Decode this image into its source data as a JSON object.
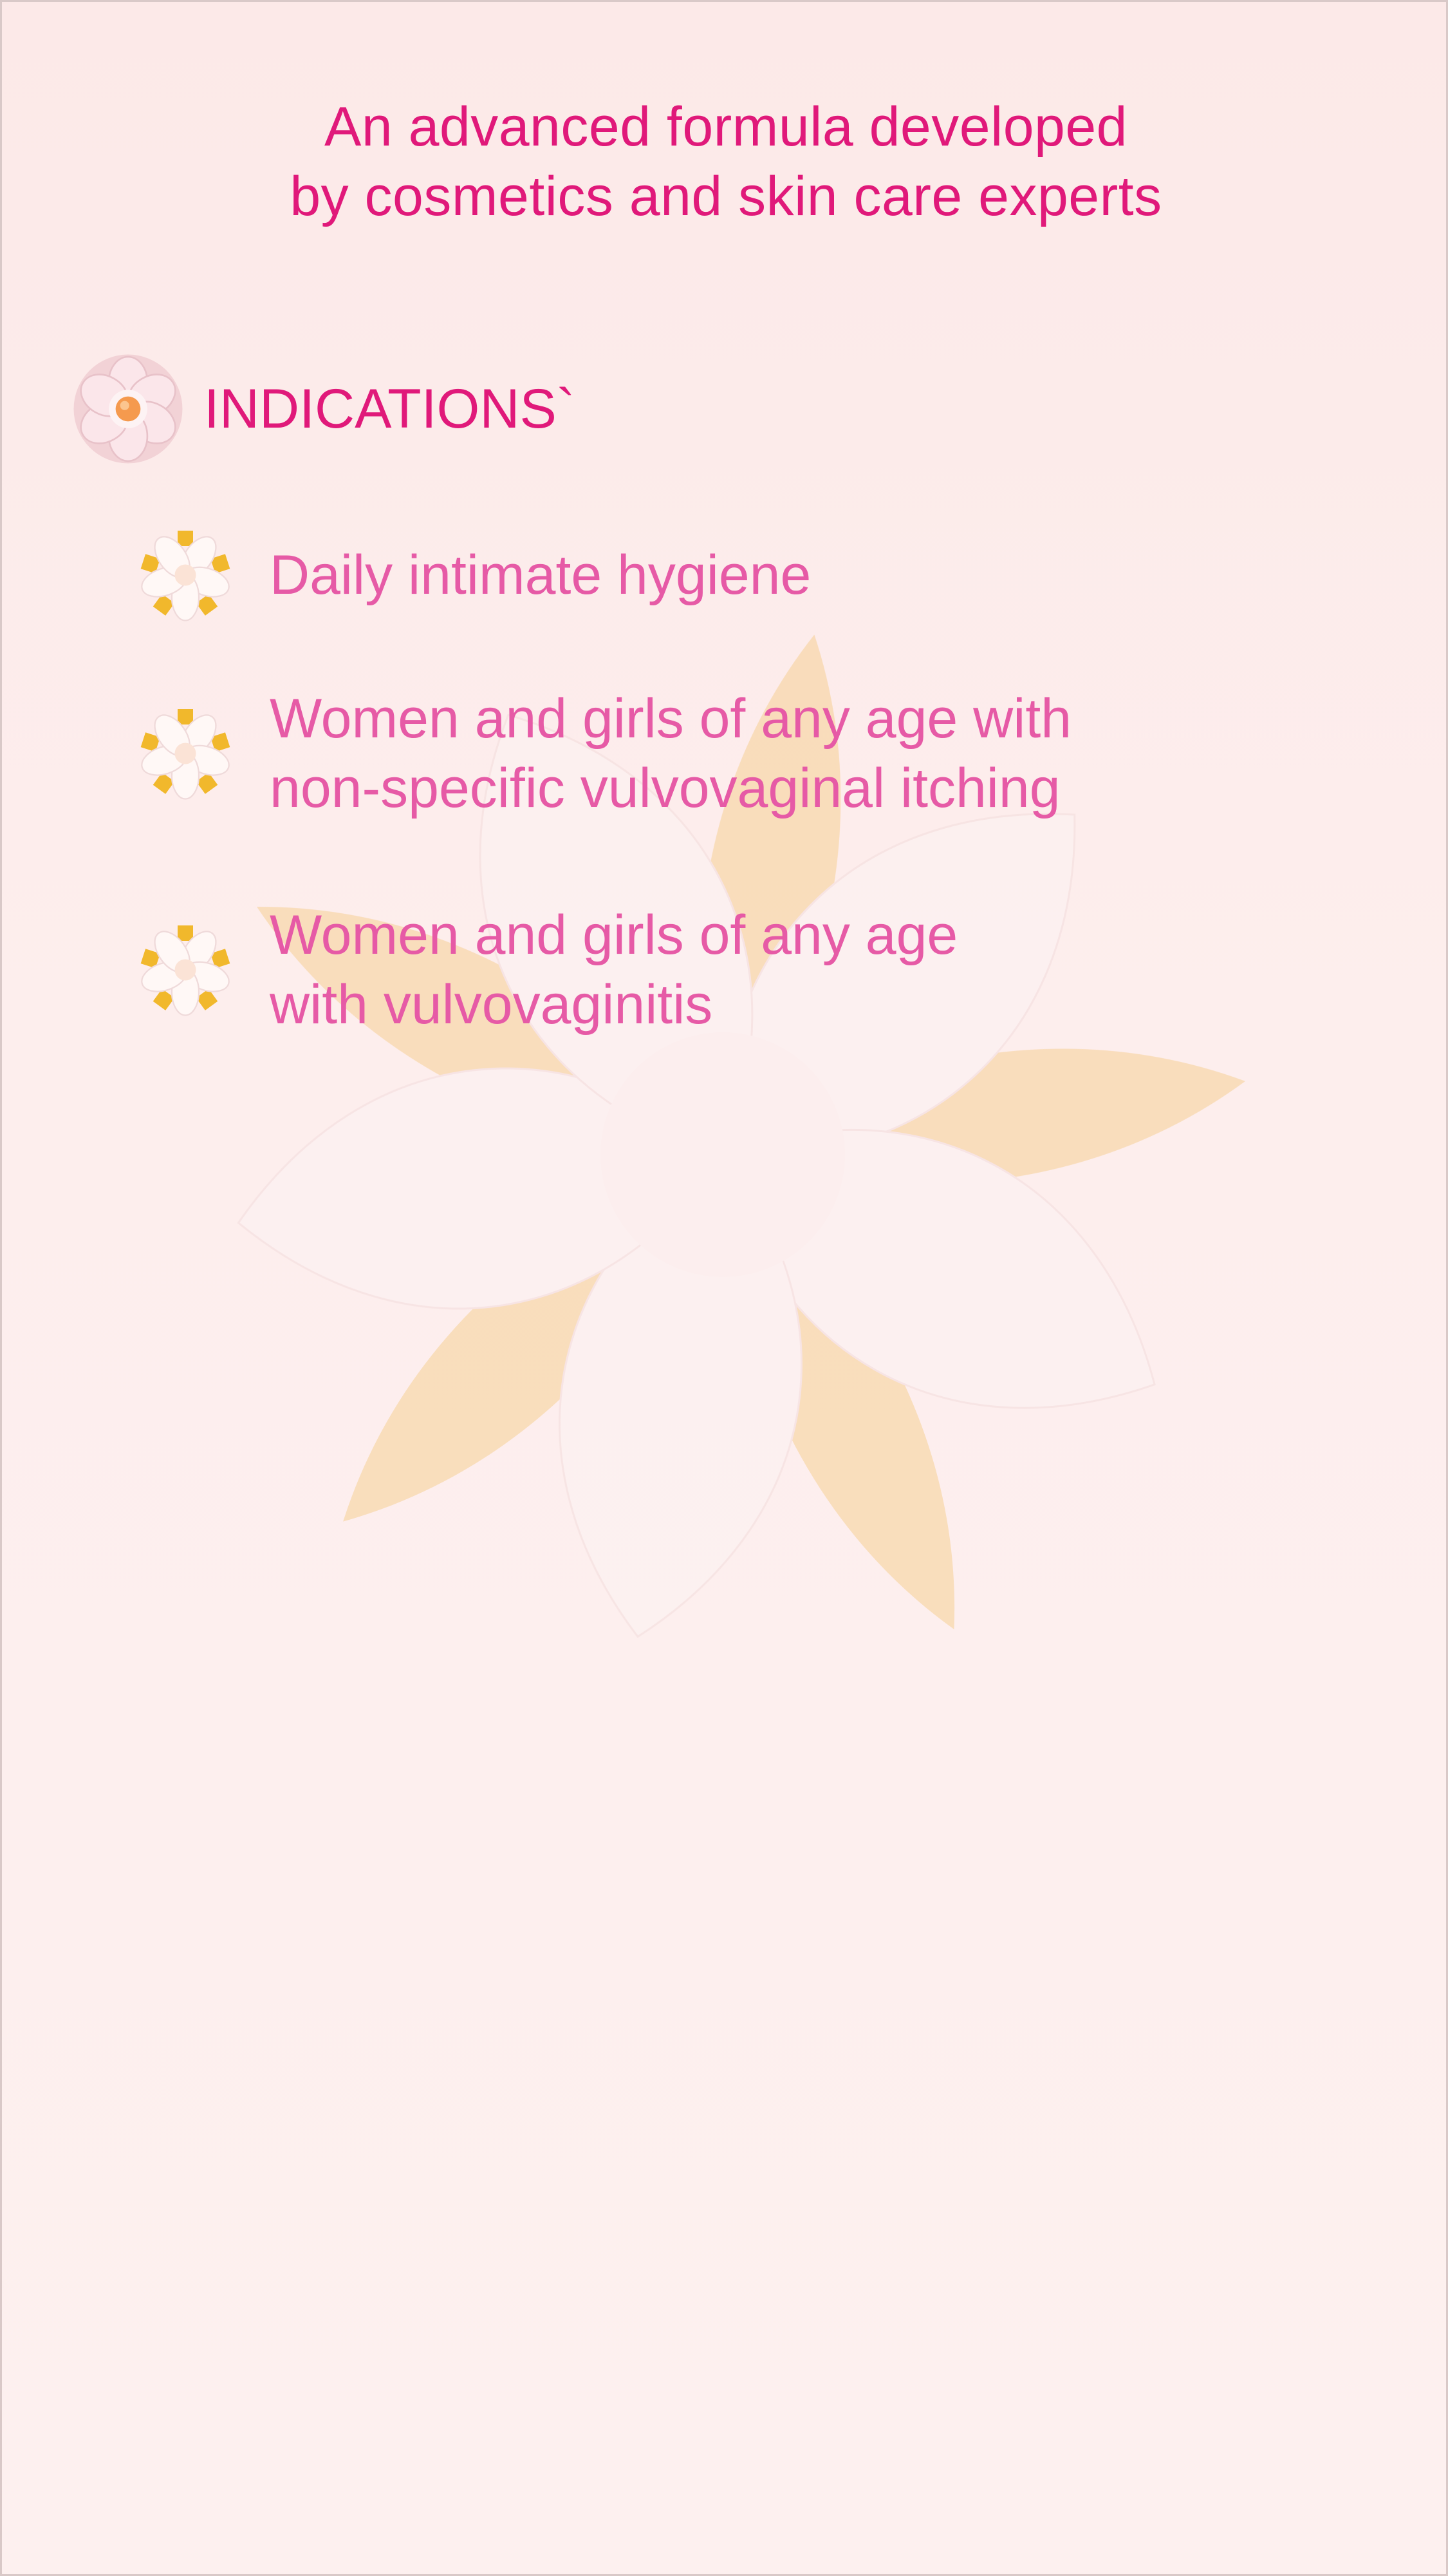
{
  "headline": {
    "line1": "An advanced formula developed",
    "line2": "by cosmetics and skin care experts"
  },
  "section": {
    "title": "INDICATIONS`",
    "icon": "pink-flower-icon"
  },
  "indications": [
    {
      "icon": "daisy-bullet-icon",
      "line1": "Daily intimate hygiene",
      "line2": ""
    },
    {
      "icon": "daisy-bullet-icon",
      "line1": "Women and girls of any age with",
      "line2": "non-specific vulvovaginal itching"
    },
    {
      "icon": "daisy-bullet-icon",
      "line1": "Women and girls of any age",
      "line2": "with vulvovaginitis"
    }
  ],
  "colors": {
    "headline": "#e0197a",
    "item_text": "#e65aa6",
    "background": "#fdeeec",
    "petal_gold": "#f8d9a6"
  }
}
